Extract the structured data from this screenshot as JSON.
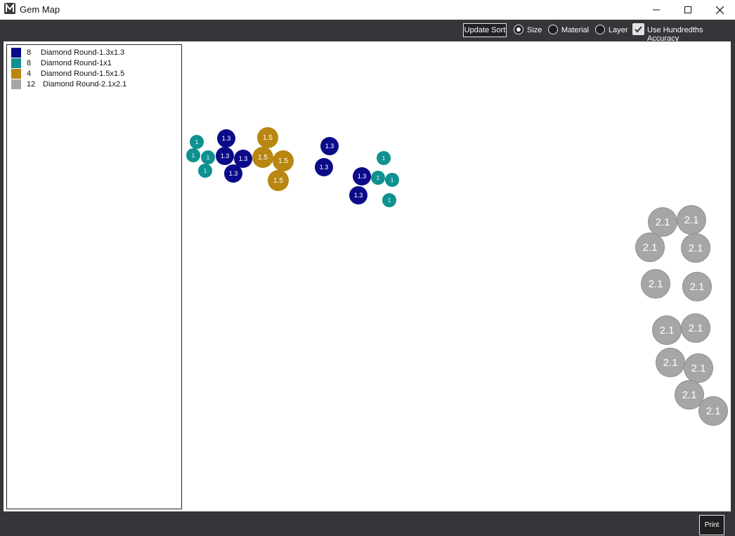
{
  "window": {
    "title": "Gem Map",
    "icon": "m-logo-icon",
    "controls": [
      "minimize-icon",
      "maximize-icon",
      "close-icon"
    ]
  },
  "toolbar": {
    "update_sort_label": "Update Sort",
    "sort_options": [
      {
        "label": "Size",
        "selected": true
      },
      {
        "label": "Material",
        "selected": false
      },
      {
        "label": "Layer",
        "selected": false
      }
    ],
    "hundredths_label": "Use Hundredths Accuracy",
    "hundredths_checked": true
  },
  "legend": {
    "items": [
      {
        "count": "8",
        "label": "Diamond Round-1.3x1.3",
        "color": "#0b0b8a"
      },
      {
        "count": "8",
        "label": "Diamond Round-1x1",
        "color": "#0f9191"
      },
      {
        "count": "4",
        "label": "Diamond Round-1.5x1.5",
        "color": "#b88712"
      },
      {
        "count": "12",
        "label": "Diamond Round-2.1x2.1",
        "color": "#a6a6a6"
      }
    ]
  },
  "gem_labels": {
    "navy": "1.3",
    "teal": "1",
    "gold": "1.5",
    "gray": "2.1"
  },
  "bottom": {
    "print_label": "Print"
  }
}
